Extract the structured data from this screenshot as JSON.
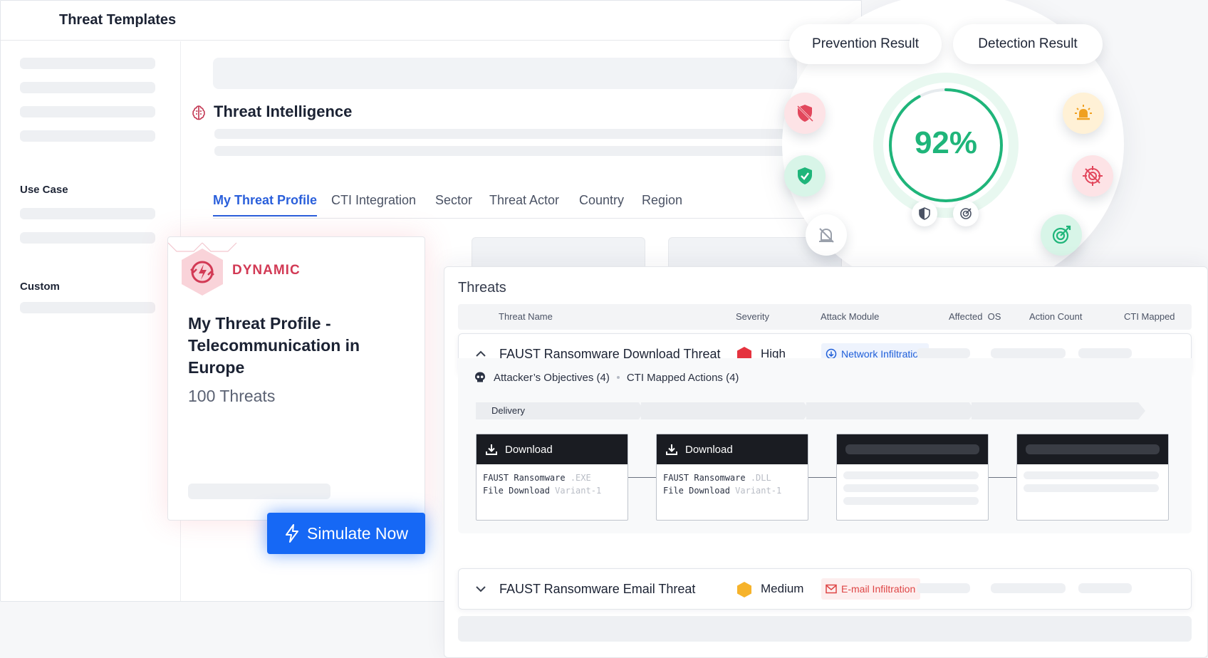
{
  "app": {
    "title": "Threat Templates"
  },
  "sidebar": {
    "use_case_label": "Use Case",
    "custom_label": "Custom"
  },
  "page": {
    "title": "Threat Intelligence",
    "title_icon": "brain-icon"
  },
  "tabs": [
    {
      "label": "My Threat Profile",
      "active": true
    },
    {
      "label": "CTI Integration",
      "active": false
    },
    {
      "label": "Sector",
      "active": false
    },
    {
      "label": "Threat Actor",
      "active": false
    },
    {
      "label": "Country",
      "active": false
    },
    {
      "label": "Region",
      "active": false
    }
  ],
  "profile_card": {
    "badge": "DYNAMIC",
    "title": "My Threat Profile - Telecommunication in Europe",
    "count": "100 Threats"
  },
  "simulate_button": {
    "label": "Simulate Now",
    "icon": "lightning-icon"
  },
  "results": {
    "prevention_label": "Prevention Result",
    "detection_label": "Detection Result",
    "score": "92%",
    "score_fraction": 0.92,
    "accent_green": "#1fb57a",
    "accent_red": "#e2475c",
    "accent_orange": "#f0a020"
  },
  "threats": {
    "title": "Threats",
    "columns": [
      "Threat Name",
      "Severity",
      "Attack Module",
      "Affected  OS",
      "Action Count",
      "CTI Mapped"
    ],
    "rows": [
      {
        "name": "FAUST Ransomware Download Threat",
        "severity": "High",
        "severity_color": "#e5333f",
        "module": "Network Infiltration",
        "module_icon": "download-circle-icon",
        "expanded": true
      },
      {
        "name": "FAUST Ransomware Email Threat",
        "severity": "Medium",
        "severity_color": "#f6b32b",
        "module": "E-mail Infiltration",
        "module_icon": "envelope-icon",
        "expanded": false
      }
    ],
    "expanded_detail": {
      "objectives": "Attacker’s Objectives (4)",
      "cti_actions": "CTI Mapped Actions (4)",
      "phase": "Delivery",
      "actions": [
        {
          "title": "Download",
          "line1": "FAUST Ransomware",
          "ext": ".EXE",
          "line2": "File Download",
          "variant": "Variant-1"
        },
        {
          "title": "Download",
          "line1": "FAUST Ransomware",
          "ext": ".DLL",
          "line2": "File Download",
          "variant": "Variant-1"
        }
      ]
    }
  }
}
